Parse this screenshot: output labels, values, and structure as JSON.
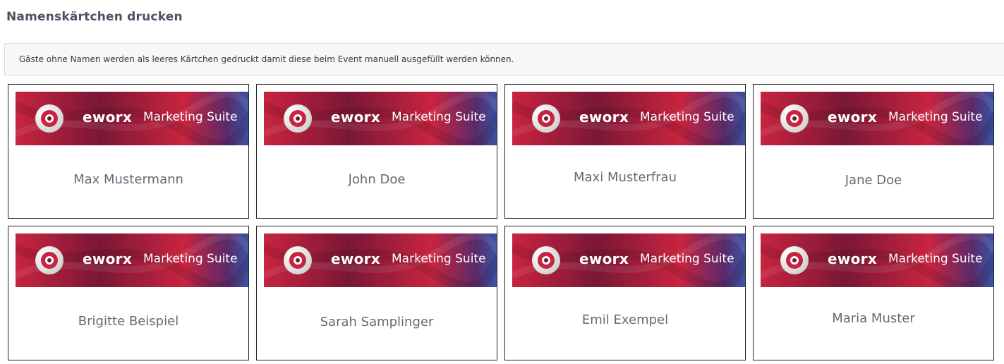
{
  "page": {
    "title": "Namenskärtchen drucken",
    "info": "Gäste ohne Namen werden als leeres Kärtchen gedruckt damit diese beim Event manuell ausgefüllt werden können."
  },
  "banner": {
    "brand": "eworx",
    "product": "Marketing Suite",
    "logo_icon": "eworx-ring-logo-icon",
    "colors": {
      "red": "#c8243f",
      "dark_red": "#7a1736",
      "purple": "#5a2a6a",
      "blue": "#2f63b8"
    }
  },
  "cards": [
    {
      "name": "Max Mustermann"
    },
    {
      "name": "John Doe"
    },
    {
      "name": "Maxi Musterfrau"
    },
    {
      "name": "Jane Doe"
    },
    {
      "name": "Brigitte Beispiel"
    },
    {
      "name": "Sarah Samplinger"
    },
    {
      "name": "Emil Exempel"
    },
    {
      "name": "Maria Muster"
    }
  ]
}
